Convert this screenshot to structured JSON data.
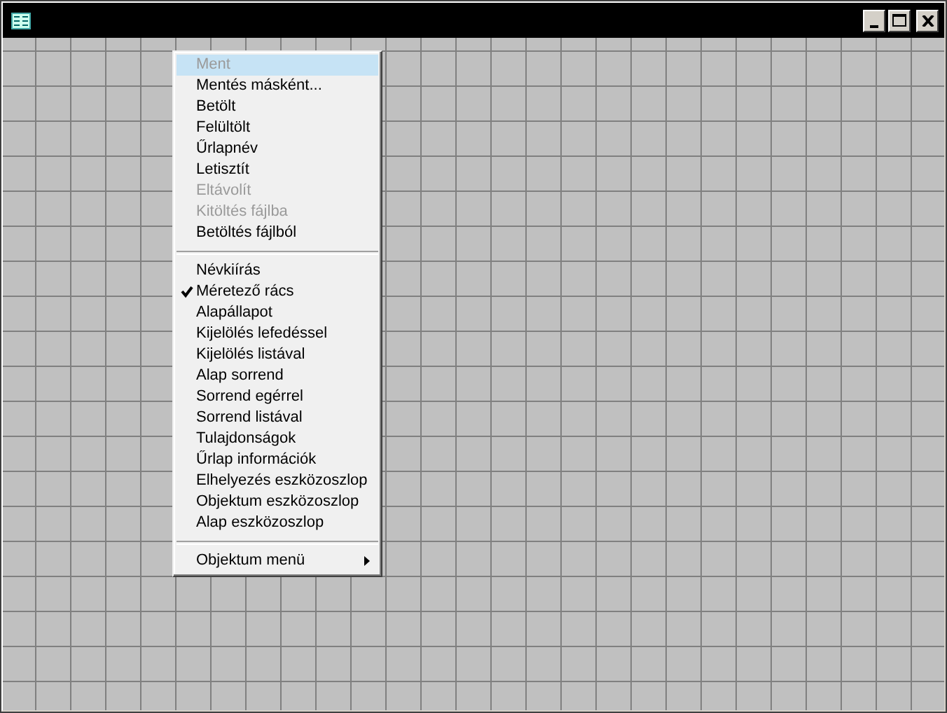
{
  "window": {
    "buttons": [
      {
        "kind": "minimize"
      },
      {
        "kind": "maximize"
      },
      {
        "kind": "close"
      }
    ]
  },
  "menu": {
    "groups": [
      {
        "items": [
          {
            "label": "Ment",
            "kind": "command",
            "disabled": true,
            "selected": true,
            "checked": false
          },
          {
            "label": "Mentés másként...",
            "kind": "command",
            "disabled": false,
            "selected": false,
            "checked": false
          },
          {
            "label": "Betölt",
            "kind": "command",
            "disabled": false,
            "selected": false,
            "checked": false
          },
          {
            "label": "Felültölt",
            "kind": "command",
            "disabled": false,
            "selected": false,
            "checked": false
          },
          {
            "label": "Űrlapnév",
            "kind": "command",
            "disabled": false,
            "selected": false,
            "checked": false
          },
          {
            "label": "Letisztít",
            "kind": "command",
            "disabled": false,
            "selected": false,
            "checked": false
          },
          {
            "label": "Eltávolít",
            "kind": "command",
            "disabled": true,
            "selected": false,
            "checked": false
          },
          {
            "label": "Kitöltés fájlba",
            "kind": "command",
            "disabled": true,
            "selected": false,
            "checked": false
          },
          {
            "label": "Betöltés fájlból",
            "kind": "command",
            "disabled": false,
            "selected": false,
            "checked": false
          }
        ]
      },
      {
        "items": [
          {
            "label": "Névkiírás",
            "kind": "command",
            "disabled": false,
            "selected": false,
            "checked": false
          },
          {
            "label": "Méretező rács",
            "kind": "command",
            "disabled": false,
            "selected": false,
            "checked": true
          },
          {
            "label": "Alapállapot",
            "kind": "command",
            "disabled": false,
            "selected": false,
            "checked": false
          },
          {
            "label": "Kijelölés lefedéssel",
            "kind": "command",
            "disabled": false,
            "selected": false,
            "checked": false
          },
          {
            "label": "Kijelölés listával",
            "kind": "command",
            "disabled": false,
            "selected": false,
            "checked": false
          },
          {
            "label": "Alap sorrend",
            "kind": "command",
            "disabled": false,
            "selected": false,
            "checked": false
          },
          {
            "label": "Sorrend egérrel",
            "kind": "command",
            "disabled": false,
            "selected": false,
            "checked": false
          },
          {
            "label": "Sorrend listával",
            "kind": "command",
            "disabled": false,
            "selected": false,
            "checked": false
          },
          {
            "label": "Tulajdonságok",
            "kind": "command",
            "disabled": false,
            "selected": false,
            "checked": false
          },
          {
            "label": "Űrlap információk",
            "kind": "command",
            "disabled": false,
            "selected": false,
            "checked": false
          },
          {
            "label": "Elhelyezés eszközoszlop",
            "kind": "command",
            "disabled": false,
            "selected": false,
            "checked": false
          },
          {
            "label": "Objektum eszközoszlop",
            "kind": "command",
            "disabled": false,
            "selected": false,
            "checked": false
          },
          {
            "label": "Alap eszközoszlop",
            "kind": "command",
            "disabled": false,
            "selected": false,
            "checked": false
          }
        ]
      },
      {
        "items": [
          {
            "label": "Objektum menü",
            "kind": "submenu",
            "disabled": false,
            "selected": false,
            "checked": false
          }
        ]
      }
    ]
  }
}
